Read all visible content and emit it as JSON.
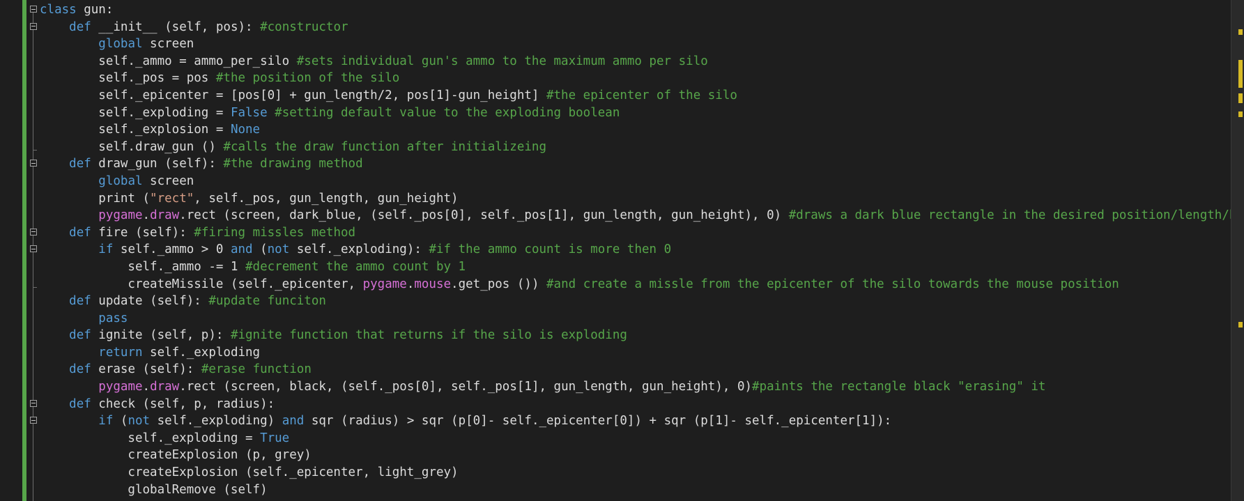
{
  "editor": {
    "lines": [
      [
        [
          "kw",
          "class"
        ],
        [
          "tx",
          " gun:"
        ]
      ],
      [
        [
          "tx",
          "    "
        ],
        [
          "kw",
          "def"
        ],
        [
          "tx",
          " __init__ (self, pos): "
        ],
        [
          "cm",
          "#constructor"
        ]
      ],
      [
        [
          "tx",
          "        "
        ],
        [
          "kw",
          "global"
        ],
        [
          "tx",
          " screen"
        ]
      ],
      [
        [
          "tx",
          "        self._ammo = ammo_per_silo "
        ],
        [
          "cm",
          "#sets individual gun's ammo to the maximum ammo per silo"
        ]
      ],
      [
        [
          "tx",
          "        self._pos = pos "
        ],
        [
          "cm",
          "#the position of the silo"
        ]
      ],
      [
        [
          "tx",
          "        self._epicenter = [pos[0] + gun_length/2, pos[1]-gun_height] "
        ],
        [
          "cm",
          "#the epicenter of the silo"
        ]
      ],
      [
        [
          "tx",
          "        self._exploding = "
        ],
        [
          "kw",
          "False"
        ],
        [
          "tx",
          " "
        ],
        [
          "cm",
          "#setting default value to the exploding boolean"
        ]
      ],
      [
        [
          "tx",
          "        self._explosion = "
        ],
        [
          "kw",
          "None"
        ]
      ],
      [
        [
          "tx",
          "        self.draw_gun () "
        ],
        [
          "cm",
          "#calls the draw function after initializeing"
        ]
      ],
      [
        [
          "tx",
          "    "
        ],
        [
          "kw",
          "def"
        ],
        [
          "tx",
          " draw_gun (self): "
        ],
        [
          "cm",
          "#the drawing method"
        ]
      ],
      [
        [
          "tx",
          "        "
        ],
        [
          "kw",
          "global"
        ],
        [
          "tx",
          " screen"
        ]
      ],
      [
        [
          "tx",
          "        print ("
        ],
        [
          "st",
          "\"rect\""
        ],
        [
          "tx",
          ", self._pos, gun_length, gun_height)"
        ]
      ],
      [
        [
          "tx",
          "        "
        ],
        [
          "pg",
          "pygame"
        ],
        [
          "tx",
          "."
        ],
        [
          "pg",
          "draw"
        ],
        [
          "tx",
          ".rect (screen, dark_blue, (self._pos[0], self._pos[1], gun_length, gun_height), 0) "
        ],
        [
          "cm",
          "#draws a dark blue rectangle in the desired position/length/heig"
        ]
      ],
      [
        [
          "tx",
          "    "
        ],
        [
          "kw",
          "def"
        ],
        [
          "tx",
          " fire (self): "
        ],
        [
          "cm",
          "#firing missles method"
        ]
      ],
      [
        [
          "tx",
          "        "
        ],
        [
          "kw",
          "if"
        ],
        [
          "tx",
          " self._ammo > 0 "
        ],
        [
          "kw",
          "and"
        ],
        [
          "tx",
          " ("
        ],
        [
          "kw",
          "not"
        ],
        [
          "tx",
          " self._exploding): "
        ],
        [
          "cm",
          "#if the ammo count is more then 0"
        ]
      ],
      [
        [
          "tx",
          "            self._ammo -= 1 "
        ],
        [
          "cm",
          "#decrement the ammo count by 1"
        ]
      ],
      [
        [
          "tx",
          "            createMissile (self._epicenter, "
        ],
        [
          "pg",
          "pygame"
        ],
        [
          "tx",
          "."
        ],
        [
          "pg",
          "mouse"
        ],
        [
          "tx",
          ".get_pos ()) "
        ],
        [
          "cm",
          "#and create a missle from the epicenter of the silo towards the mouse position"
        ]
      ],
      [
        [
          "tx",
          "    "
        ],
        [
          "kw",
          "def"
        ],
        [
          "tx",
          " update (self): "
        ],
        [
          "cm",
          "#update funciton"
        ]
      ],
      [
        [
          "tx",
          "        "
        ],
        [
          "kw",
          "pass"
        ]
      ],
      [
        [
          "tx",
          "    "
        ],
        [
          "kw",
          "def"
        ],
        [
          "tx",
          " ignite (self, p): "
        ],
        [
          "cm",
          "#ignite function that returns if the silo is exploding"
        ]
      ],
      [
        [
          "tx",
          "        "
        ],
        [
          "kw",
          "return"
        ],
        [
          "tx",
          " self._exploding"
        ]
      ],
      [
        [
          "tx",
          "    "
        ],
        [
          "kw",
          "def"
        ],
        [
          "tx",
          " erase (self): "
        ],
        [
          "cm",
          "#erase function"
        ]
      ],
      [
        [
          "tx",
          "        "
        ],
        [
          "pg",
          "pygame"
        ],
        [
          "tx",
          "."
        ],
        [
          "pg",
          "draw"
        ],
        [
          "tx",
          ".rect (screen, black, (self._pos[0], self._pos[1], gun_length, gun_height), 0)"
        ],
        [
          "cm",
          "#paints the rectangle black \"erasing\" it"
        ]
      ],
      [
        [
          "tx",
          "    "
        ],
        [
          "kw",
          "def"
        ],
        [
          "tx",
          " check (self, p, radius):"
        ]
      ],
      [
        [
          "tx",
          "        "
        ],
        [
          "kw",
          "if"
        ],
        [
          "tx",
          " ("
        ],
        [
          "kw",
          "not"
        ],
        [
          "tx",
          " self._exploding) "
        ],
        [
          "kw",
          "and"
        ],
        [
          "tx",
          " sqr (radius) > sqr (p[0]- self._epicenter[0]) + sqr (p[1]- self._epicenter[1]):"
        ]
      ],
      [
        [
          "tx",
          "            self._exploding = "
        ],
        [
          "kw",
          "True"
        ]
      ],
      [
        [
          "tx",
          "            createExplosion (p, grey)"
        ]
      ],
      [
        [
          "tx",
          "            createExplosion (self._epicenter, light_grey)"
        ]
      ],
      [
        [
          "tx",
          "            globalRemove (self)"
        ]
      ]
    ]
  },
  "colors": {
    "background": "#1e1e1e",
    "keyword": "#569cd6",
    "comment": "#57a64a",
    "string": "#d69d85",
    "module": "#d670d6",
    "text": "#dcdcdc",
    "change_bar": "#57a64a"
  }
}
